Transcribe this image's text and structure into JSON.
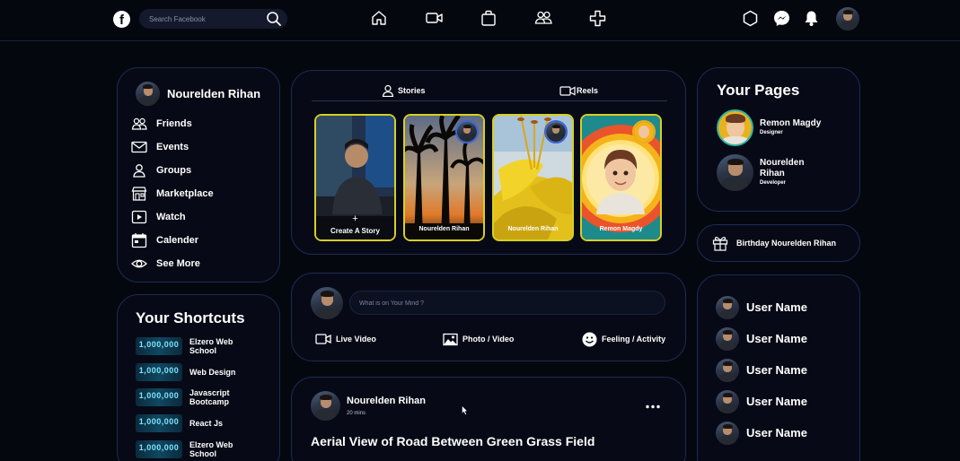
{
  "colors": {
    "background": "#05070f",
    "panel_border": "#1d2a55",
    "story_border": "#d7d020"
  },
  "header": {
    "logo_letter": "f",
    "search_placeholder": "Search Facebook",
    "nav_icons": [
      "home-icon",
      "video-icon",
      "marketplace-icon",
      "groups-icon",
      "gaming-icon"
    ],
    "right_icons": [
      "hexagon-icon",
      "messenger-icon",
      "bell-icon",
      "avatar"
    ]
  },
  "profile": {
    "name": "Nourelden Rihan"
  },
  "menu": {
    "items": [
      {
        "label": "Friends",
        "icon": "friends-icon"
      },
      {
        "label": "Events",
        "icon": "events-icon"
      },
      {
        "label": "Groups",
        "icon": "groups-icon"
      },
      {
        "label": "Marketplace",
        "icon": "marketplace-icon"
      },
      {
        "label": "Watch",
        "icon": "watch-icon"
      },
      {
        "label": "Calender",
        "icon": "calendar-icon"
      },
      {
        "label": "See More",
        "icon": "eye-icon"
      }
    ]
  },
  "shortcuts": {
    "title": "Your Shortcuts",
    "thumb_text": "1,000,000",
    "items": [
      {
        "label": "Elzero Web School"
      },
      {
        "label": "Web Design"
      },
      {
        "label": "Javascript Bootcamp"
      },
      {
        "label": "React Js"
      },
      {
        "label": "Elzero Web School"
      }
    ]
  },
  "stories": {
    "tabs": [
      {
        "label": "Stories"
      },
      {
        "label": "Reels"
      }
    ],
    "create_plus": "+",
    "items": [
      {
        "label": "Create A Story"
      },
      {
        "label": "Nourelden Rihan"
      },
      {
        "label": "Nourelden Rihan"
      },
      {
        "label": "Remon Magdy"
      }
    ]
  },
  "composer": {
    "placeholder": "What is on Your Mind ?",
    "actions": [
      {
        "label": "Live Video"
      },
      {
        "label": "Photo / Video"
      },
      {
        "label": "Feeling / Activity"
      }
    ]
  },
  "post": {
    "author": "Nourelden Rihan",
    "time": "20 mins",
    "title": "Aerial View of Road Between Green Grass Field"
  },
  "pages": {
    "title": "Your Pages",
    "items": [
      {
        "name": "Remon Magdy",
        "role": "Designer"
      },
      {
        "name": "Nourelden Rihan",
        "role": "Developer"
      }
    ]
  },
  "birthday": {
    "label": "Birthday Nourelden Rihan"
  },
  "contacts": {
    "users": [
      {
        "name": "User Name"
      },
      {
        "name": "User Name"
      },
      {
        "name": "User Name"
      },
      {
        "name": "User Name"
      },
      {
        "name": "User Name"
      }
    ]
  }
}
